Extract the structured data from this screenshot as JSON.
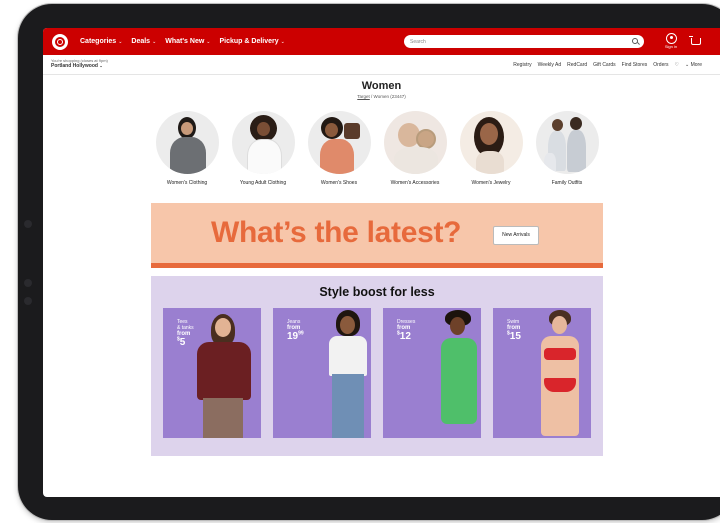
{
  "header": {
    "nav": [
      {
        "label": "Categories"
      },
      {
        "label": "Deals"
      },
      {
        "label": "What's New"
      },
      {
        "label": "Pickup & Delivery"
      }
    ],
    "search_placeholder": "Search",
    "signin_label": "Sign in"
  },
  "subbar": {
    "store_line1": "You're shopping (closes at 9pm)",
    "store_line2": "Portland Hollywood",
    "links": [
      "Registry",
      "Weekly Ad",
      "RedCard",
      "Gift Cards",
      "Find Stores",
      "Orders",
      "♡",
      "⌄ More"
    ]
  },
  "page": {
    "title": "Women",
    "breadcrumb_link": "Target",
    "breadcrumb_rest": " / Women (23447)"
  },
  "categories": [
    {
      "label": "Women's Clothing"
    },
    {
      "label": "Young Adult Clothing"
    },
    {
      "label": "Women's Shoes"
    },
    {
      "label": "Women's Accessories"
    },
    {
      "label": "Women's Jewelry"
    },
    {
      "label": "Family Outfits"
    }
  ],
  "banner": {
    "headline": "What’s the latest?",
    "button": "New Arrivals",
    "colors": {
      "bg": "#f7c6aa",
      "accent": "#e76a3c"
    }
  },
  "style_boost": {
    "title": "Style boost for less",
    "tiles": [
      {
        "line1": "Tees",
        "line2": "& tanks",
        "from": "from",
        "price": "5",
        "cents": ""
      },
      {
        "line1": "Jeans",
        "line2": "",
        "from": "from",
        "price": "19",
        "cents": "99"
      },
      {
        "line1": "Dresses",
        "line2": "",
        "from": "from",
        "price": "12",
        "cents": ""
      },
      {
        "line1": "Swim",
        "line2": "",
        "from": "from",
        "price": "15",
        "cents": ""
      }
    ]
  },
  "colors": {
    "brand": "#cc0000",
    "tile": "#9a7fd0",
    "section": "#ddd3ec"
  }
}
